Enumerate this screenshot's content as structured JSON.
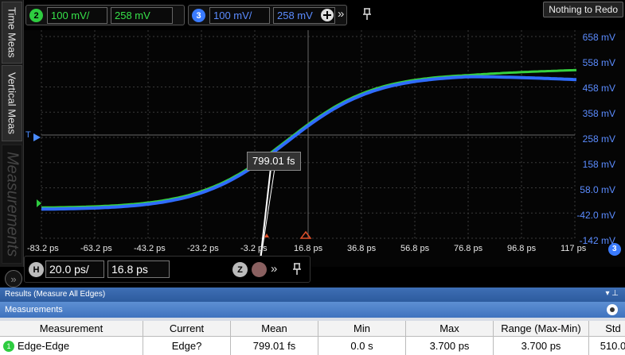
{
  "left_tabs": {
    "time_meas": "Time Meas",
    "vertical_meas": "Vertical Meas",
    "measurements": "Measurements"
  },
  "expand_icon": "»",
  "channels": [
    {
      "number": "2",
      "scale": "100 mV/",
      "offset": "258 mV",
      "color": "#2ecc40"
    },
    {
      "number": "3",
      "scale": "100 mV/",
      "offset": "258 mV",
      "color": "#3a7bff"
    }
  ],
  "toolbar": {
    "add_icon": "plus-circle-icon",
    "more_icon": "»",
    "pin_icon": "pin-icon",
    "redo_label": "Nothing to Redo"
  },
  "yticks": [
    "658 mV",
    "558 mV",
    "458 mV",
    "358 mV",
    "258 mV",
    "158 mV",
    "58.0 mV",
    "-42.0 mV",
    "-142 mV"
  ],
  "xticks": [
    "-83.2 ps",
    "-63.2 ps",
    "-43.2 ps",
    "-23.2 ps",
    "-3.2 ps",
    "16.8 ps",
    "36.8 ps",
    "56.8 ps",
    "76.8 ps",
    "96.8 ps",
    "117 ps"
  ],
  "trigger_marker": "T",
  "marker_tooltip": "799.01 fs",
  "horizontal": {
    "label": "H",
    "scale": "20.0 ps/",
    "position": "16.8 ps",
    "zoom_label": "Z"
  },
  "results": {
    "title": "Results  (Measure All Edges)",
    "panel": "Measurements",
    "columns": [
      "Measurement",
      "Current",
      "Mean",
      "Min",
      "Max",
      "Range (Max-Min)",
      "Std"
    ],
    "rows": [
      {
        "index": "1",
        "measurement": "Edge-Edge",
        "current": "Edge?",
        "mean": "799.01 fs",
        "min": "0.0 s",
        "max": "3.700 ps",
        "range": "3.700 ps",
        "std": "510.0"
      }
    ]
  }
}
